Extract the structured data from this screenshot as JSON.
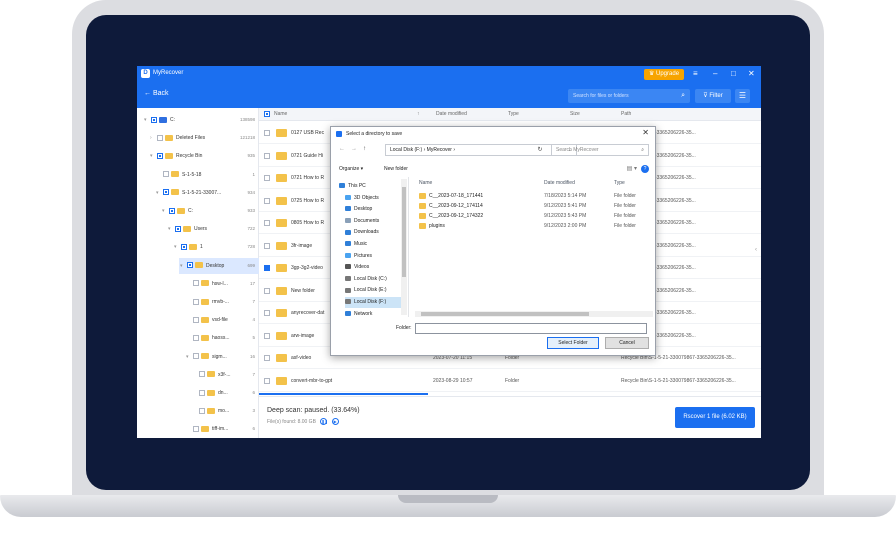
{
  "app": {
    "name": "MyRecover",
    "upgrade_label": "Upgrade",
    "back_label": "Back",
    "search_placeholder": "Search for files or folders",
    "filter_label": "Filter",
    "accent": "#1b6ff0"
  },
  "tree": [
    {
      "label": "C:",
      "count": "138598",
      "indent": 0,
      "arrow": "▾",
      "check": "partial",
      "icon": "drive"
    },
    {
      "label": "Deleted Files",
      "count": "121218",
      "indent": 1,
      "arrow": "›",
      "check": "none",
      "icon": "folder"
    },
    {
      "label": "Recycle Bin",
      "count": "935",
      "indent": 1,
      "arrow": "▾",
      "check": "partial",
      "icon": "folder"
    },
    {
      "label": "S-1-5-18",
      "count": "1",
      "indent": 2,
      "arrow": "",
      "check": "none",
      "icon": "folder"
    },
    {
      "label": "S-1-5-21-33007...",
      "count": "934",
      "indent": 2,
      "arrow": "▾",
      "check": "partial",
      "icon": "folder"
    },
    {
      "label": "C:",
      "count": "933",
      "indent": 3,
      "arrow": "▾",
      "check": "partial",
      "icon": "folder"
    },
    {
      "label": "Users",
      "count": "722",
      "indent": 4,
      "arrow": "▾",
      "check": "partial",
      "icon": "folder"
    },
    {
      "label": "1",
      "count": "728",
      "indent": 5,
      "arrow": "▾",
      "check": "partial",
      "icon": "folder"
    },
    {
      "label": "Desktop",
      "count": "699",
      "indent": 6,
      "arrow": "▾",
      "check": "partial",
      "icon": "folder",
      "selected": true
    },
    {
      "label": "hsw-l...",
      "count": "17",
      "indent": 7,
      "arrow": "",
      "check": "none",
      "icon": "folder"
    },
    {
      "label": "rmvb-...",
      "count": "7",
      "indent": 7,
      "arrow": "",
      "check": "none",
      "icon": "folder"
    },
    {
      "label": "vsd-file",
      "count": "4",
      "indent": 7,
      "arrow": "",
      "check": "none",
      "icon": "folder"
    },
    {
      "label": "haoss...",
      "count": "5",
      "indent": 7,
      "arrow": "",
      "check": "none",
      "icon": "folder"
    },
    {
      "label": "sigm...",
      "count": "16",
      "indent": 7,
      "arrow": "▾",
      "check": "none",
      "icon": "folder"
    },
    {
      "label": "x3f-...",
      "count": "7",
      "indent": 8,
      "arrow": "",
      "check": "none",
      "icon": "folder"
    },
    {
      "label": "dn...",
      "count": "6",
      "indent": 8,
      "arrow": "",
      "check": "none",
      "icon": "folder"
    },
    {
      "label": "mo...",
      "count": "3",
      "indent": 8,
      "arrow": "",
      "check": "none",
      "icon": "folder"
    },
    {
      "label": "tiff-im...",
      "count": "6",
      "indent": 7,
      "arrow": "",
      "check": "none",
      "icon": "folder"
    }
  ],
  "list": {
    "headers": {
      "name": "Name",
      "date": "Date modified",
      "type": "Type",
      "size": "Size",
      "path": "Path"
    },
    "rows": [
      {
        "name": "0127 USB Rec",
        "date": "",
        "type": "",
        "path": "-21-330079867-3365206226-35...",
        "checked": false
      },
      {
        "name": "0721 Guide Hi",
        "date": "",
        "type": "",
        "path": "-21-330079867-3365206226-35...",
        "checked": false
      },
      {
        "name": "0721 How to R",
        "date": "",
        "type": "",
        "path": "-21-330079867-3365206226-35...",
        "checked": false
      },
      {
        "name": "0725 How to R",
        "date": "",
        "type": "",
        "path": "-21-330079867-3365206226-35...",
        "checked": false
      },
      {
        "name": "0805 How to R",
        "date": "",
        "type": "",
        "path": "-21-330079867-3365206226-35...",
        "checked": false
      },
      {
        "name": "3fr-image",
        "date": "",
        "type": "",
        "path": "-21-330079867-3365206226-35...",
        "checked": false
      },
      {
        "name": "3gp-3g2-video",
        "date": "",
        "type": "",
        "path": "-21-330079867-3365206226-35...",
        "checked": true
      },
      {
        "name": "New folder",
        "date": "",
        "type": "",
        "path": "-21-330079867-3365206226-35...",
        "checked": false
      },
      {
        "name": "anyrecover-dat",
        "date": "",
        "type": "",
        "path": "-21-330079867-3365206226-35...",
        "checked": false
      },
      {
        "name": "arw-image",
        "date": "",
        "type": "",
        "path": "-21-330079867-3365206226-35...",
        "checked": false
      },
      {
        "name": "asf-video",
        "date": "2023-07-20 11:15",
        "type": "Folder",
        "path": "Recycle Bin\\S-1-5-21-330079867-3365206226-35...",
        "checked": false
      },
      {
        "name": "convert-mbr-to-gpt",
        "date": "2023-08-29 10:57",
        "type": "Folder",
        "path": "Recycle Bin\\S-1-5-21-330079867-3365206226-35...",
        "checked": false
      }
    ]
  },
  "footer": {
    "status": "Deep scan: paused. (33.64%)",
    "progress": 0.3364,
    "found": "File(s) found: 8.00 GB",
    "recover_label": "Rscover 1 file (6.02 KB)"
  },
  "dialog": {
    "title": "Select a directory to save",
    "address": "Local Disk (F:)  ›  MyRecover  ›",
    "search_placeholder": "Search MyRecover",
    "organize": "Organize ▾",
    "new_folder": "New folder",
    "nav": [
      {
        "label": "This PC",
        "color": "#2f7fd8"
      },
      {
        "label": "3D Objects",
        "color": "#4aa3f0"
      },
      {
        "label": "Desktop",
        "color": "#2f7fd8"
      },
      {
        "label": "Documents",
        "color": "#8aa0b8"
      },
      {
        "label": "Downloads",
        "color": "#2f7fd8"
      },
      {
        "label": "Music",
        "color": "#2f7fd8"
      },
      {
        "label": "Pictures",
        "color": "#4aa3f0"
      },
      {
        "label": "Videos",
        "color": "#555"
      },
      {
        "label": "Local Disk (C:)",
        "color": "#777"
      },
      {
        "label": "Local Disk (E:)",
        "color": "#777"
      },
      {
        "label": "Local Disk (F:)",
        "color": "#777",
        "selected": true
      },
      {
        "label": "Network",
        "color": "#2f7fd8"
      }
    ],
    "columns": {
      "name": "Name",
      "date": "Date modified",
      "type": "Type"
    },
    "rows": [
      {
        "name": "C__2023-07-18_171441",
        "date": "7/18/2023 5:14 PM",
        "type": "File folder"
      },
      {
        "name": "C__2023-09-12_174114",
        "date": "9/12/2023 5:41 PM",
        "type": "File folder"
      },
      {
        "name": "C__2023-09-12_174322",
        "date": "9/12/2023 5:43 PM",
        "type": "File folder"
      },
      {
        "name": "plugins",
        "date": "9/12/2023 2:00 PM",
        "type": "File folder"
      }
    ],
    "folder_label": "Folder:",
    "select_label": "Select Folder",
    "cancel_label": "Cancel"
  }
}
